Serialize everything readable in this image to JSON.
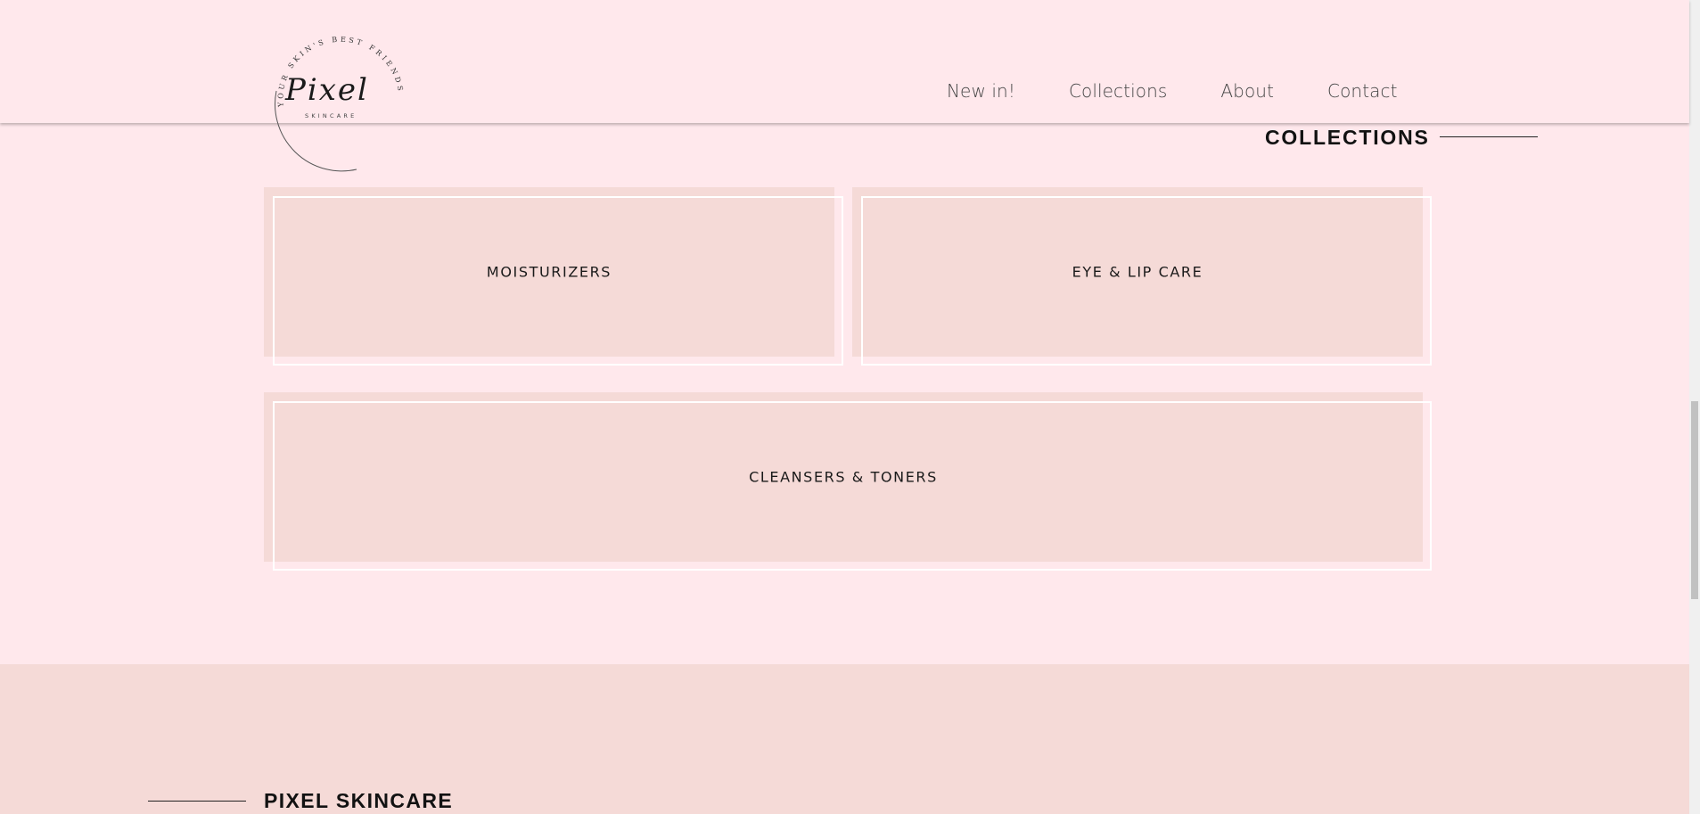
{
  "header": {
    "logo": {
      "script_name": "Pixel",
      "sub_text": "SKINCARE",
      "ring_text": "YOUR SKIN'S BEST FRIENDS"
    },
    "nav": [
      {
        "label": "New in!"
      },
      {
        "label": "Collections"
      },
      {
        "label": "About"
      },
      {
        "label": "Contact"
      }
    ]
  },
  "collections_section": {
    "title": "COLLECTIONS",
    "cards": [
      {
        "label": "MOISTURIZERS"
      },
      {
        "label": "EYE & LIP CARE"
      },
      {
        "label": "CLEANSERS & TONERS"
      }
    ]
  },
  "footer": {
    "title": "PIXEL SKINCARE"
  },
  "colors": {
    "page_bg": "#ffe8ec",
    "card_bg": "#f5dad7",
    "footer_bg": "#f5dad7",
    "text": "#121212"
  }
}
